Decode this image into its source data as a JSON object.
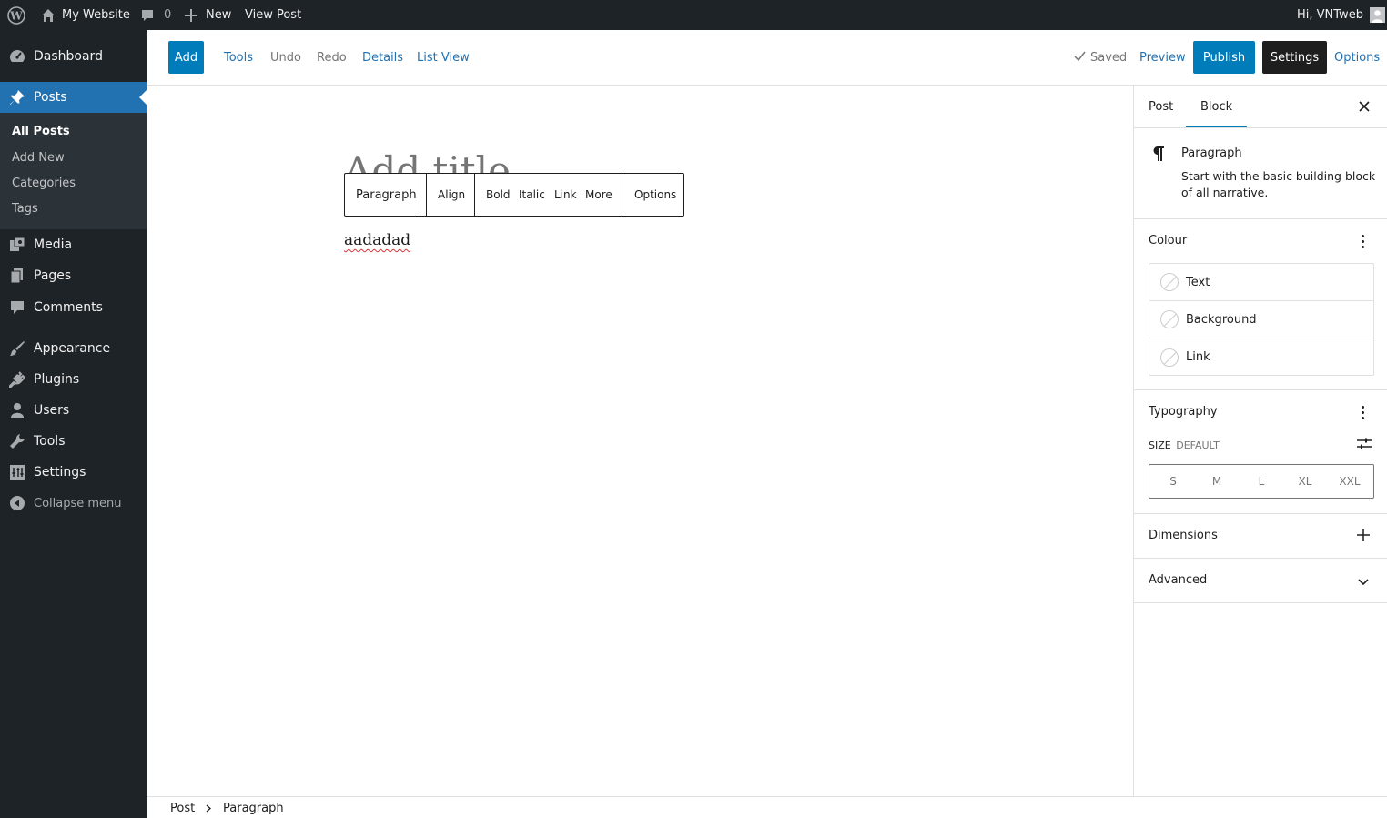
{
  "admin_bar": {
    "site_name": "My Website",
    "comments_count": "0",
    "new_label": "New",
    "view_post_label": "View Post",
    "greeting": "Hi, VNTweb"
  },
  "sidebar": {
    "items": [
      {
        "label": "Dashboard",
        "icon": "dashboard-icon"
      },
      {
        "label": "Posts",
        "icon": "pin-icon"
      },
      {
        "label": "Media",
        "icon": "media-icon"
      },
      {
        "label": "Pages",
        "icon": "pages-icon"
      },
      {
        "label": "Comments",
        "icon": "comments-icon"
      },
      {
        "label": "Appearance",
        "icon": "brush-icon"
      },
      {
        "label": "Plugins",
        "icon": "plugin-icon"
      },
      {
        "label": "Users",
        "icon": "user-icon"
      },
      {
        "label": "Tools",
        "icon": "wrench-icon"
      },
      {
        "label": "Settings",
        "icon": "settings-icon"
      }
    ],
    "submenu": [
      "All Posts",
      "Add New",
      "Categories",
      "Tags"
    ],
    "collapse_label": "Collapse menu"
  },
  "header": {
    "add": "Add",
    "tools": "Tools",
    "undo": "Undo",
    "redo": "Redo",
    "details": "Details",
    "list_view": "List View",
    "saved": "Saved",
    "preview": "Preview",
    "publish": "Publish",
    "settings": "Settings",
    "options": "Options"
  },
  "canvas": {
    "title_placeholder": "Add title",
    "paragraph_text": "aadadad",
    "toolbar": {
      "block_type": "Paragraph",
      "align": "Align",
      "bold": "Bold",
      "italic": "Italic",
      "link": "Link",
      "more": "More",
      "options": "Options"
    }
  },
  "settings_sidebar": {
    "tabs": [
      "Post",
      "Block"
    ],
    "active_tab": "Block",
    "block_name": "Paragraph",
    "block_description": "Start with the basic building block of all narrative.",
    "colour": {
      "title": "Colour",
      "items": [
        "Text",
        "Background",
        "Link"
      ]
    },
    "typography": {
      "title": "Typography",
      "size_label": "SIZE",
      "size_value": "DEFAULT",
      "sizes": [
        "S",
        "M",
        "L",
        "XL",
        "XXL"
      ]
    },
    "dimensions": "Dimensions",
    "advanced": "Advanced"
  },
  "breadcrumb": [
    "Post",
    "Paragraph"
  ],
  "colors": {
    "admin_dark": "#1d2327",
    "submenu_dark": "#2c3338",
    "accent_blue": "#2271b1",
    "primary_button": "#007cba",
    "dark_button": "#1e1e1e"
  }
}
